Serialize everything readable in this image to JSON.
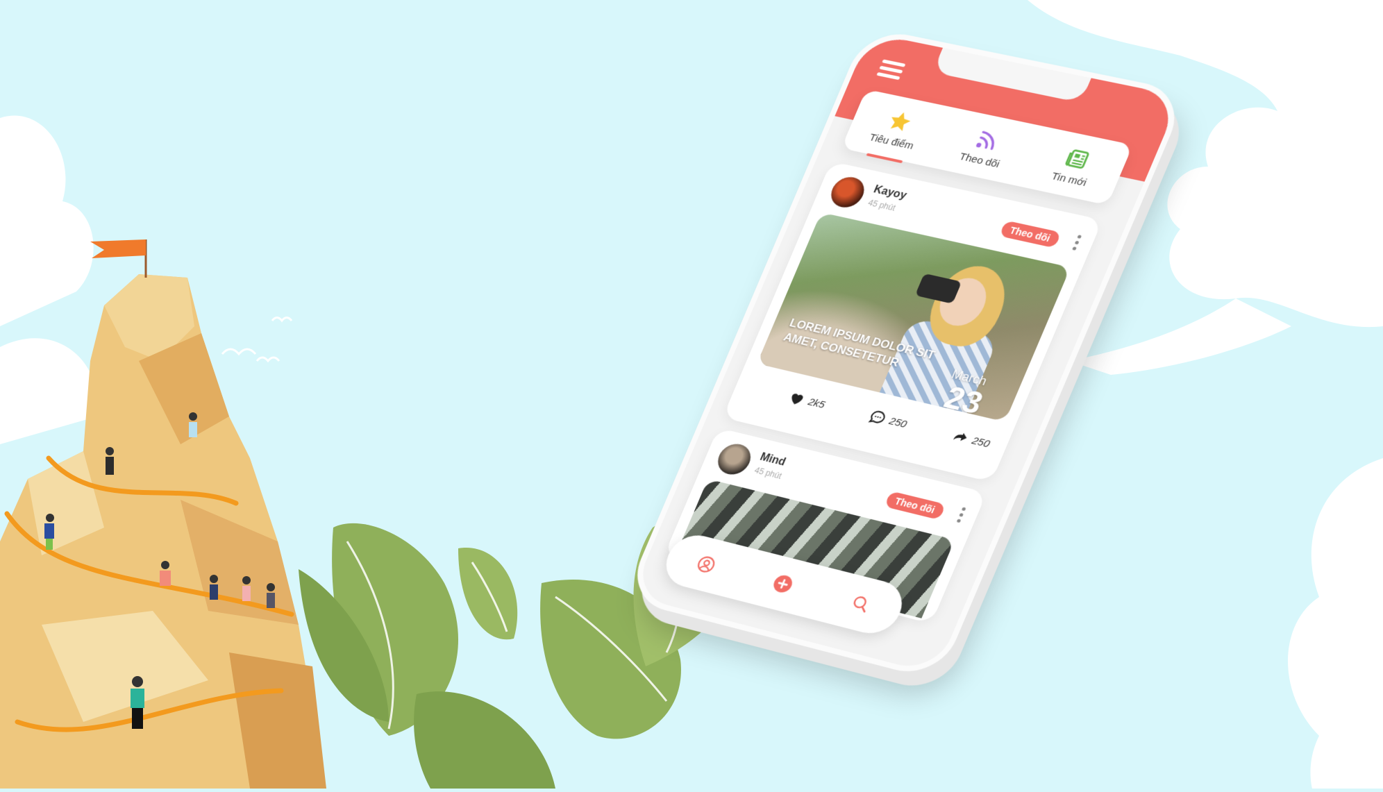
{
  "colors": {
    "sky": "#d8f7fb",
    "accent": "#f26d65",
    "leaf": "#8fb05a",
    "mountain": "#eec77e",
    "rope": "#f39a1e"
  },
  "header": {
    "menu_icon": "hamburger-icon"
  },
  "tabs": [
    {
      "label": "Tiêu điểm",
      "icon": "star-icon",
      "active": true
    },
    {
      "label": "Theo dõi",
      "icon": "rss-icon",
      "active": false
    },
    {
      "label": "Tin mới",
      "icon": "newspaper-icon",
      "active": false
    }
  ],
  "posts": [
    {
      "user": "Kayoy",
      "time": "45 phút",
      "follow_label": "Theo dõi",
      "caption": "LOREM IPSUM DOLOR SIT AMET, CONSETETUR",
      "month": "March",
      "day": "23",
      "likes": "2k5",
      "comments": "250",
      "shares": "250"
    },
    {
      "user": "Mind",
      "time": "45 phút",
      "follow_label": "Theo dõi"
    }
  ],
  "bottom_nav": [
    {
      "icon": "user-icon"
    },
    {
      "icon": "plus-icon"
    },
    {
      "icon": "search-icon"
    }
  ]
}
